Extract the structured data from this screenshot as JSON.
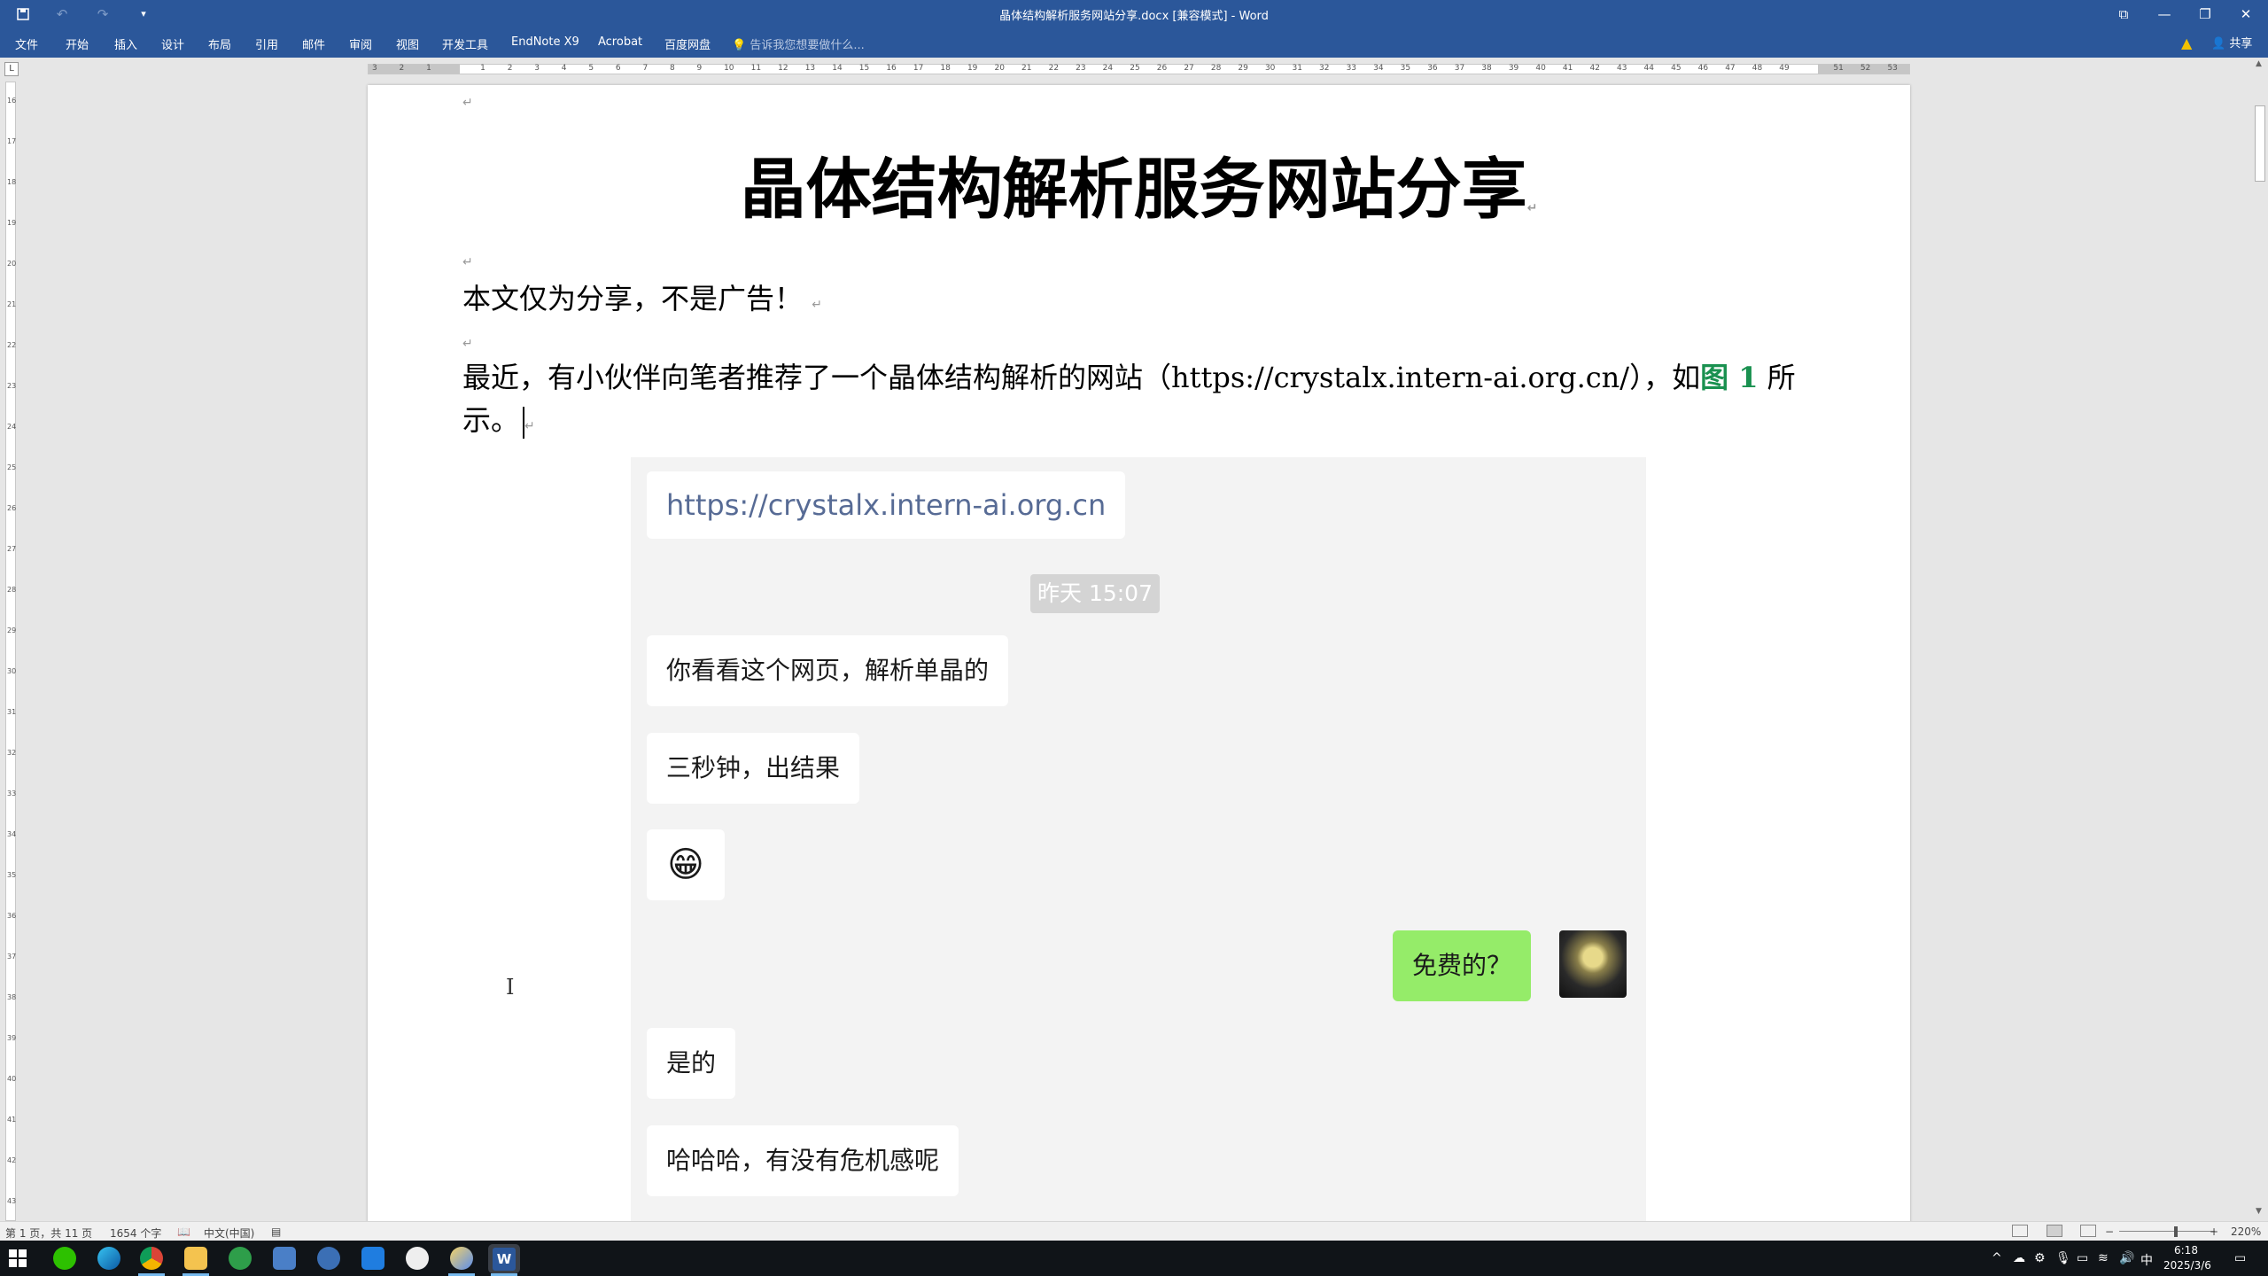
{
  "window": {
    "title": "晶体结构解析服务网站分享.docx [兼容模式] - Word",
    "minimize_glyph": "—",
    "restore_glyph": "❐",
    "close_glyph": "✕",
    "ribbon_display_glyph": "⧉"
  },
  "quick_access": {
    "save_icon": "save-icon",
    "undo_icon": "undo-icon",
    "redo_icon": "redo-icon",
    "customize_icon": "customize-icon"
  },
  "ribbon": {
    "tabs": [
      "文件",
      "开始",
      "插入",
      "设计",
      "布局",
      "引用",
      "邮件",
      "审阅",
      "视图",
      "开发工具",
      "EndNote X9",
      "Acrobat",
      "百度网盘"
    ],
    "tell_me": "告诉我您想要做什么...",
    "share": "共享"
  },
  "ruler": {
    "tab_selector": "L"
  },
  "document": {
    "heading": "晶体结构解析服务网站分享",
    "para_ad": "本文仅为分享，不是广告！",
    "para_intro_text": "最近，有小伙伴向笔者推荐了一个晶体结构解析的网站（https://crystalx.intern-ai.org.cn/），如",
    "figure_ref": "图 1",
    "para_intro_tail": "所示。",
    "para_mark": "↵"
  },
  "chat": {
    "link": "https://crystalx.intern-ai.org.cn",
    "timestamp": "昨天 15:07",
    "messages": [
      "你看看这个网页，解析单晶的",
      "三秒钟，出结果",
      "😁",
      "免费的？",
      "是的",
      "哈哈哈，有没有危机感呢"
    ],
    "bubble_colors": {
      "incoming": "#ffffff",
      "outgoing": "#95ec69",
      "link": "#576b95"
    }
  },
  "statusbar": {
    "page": "第 1 页，共 11 页",
    "word_count": "1654 个字",
    "language": "中文(中国)",
    "zoom": "220%",
    "zoom_minus": "−",
    "zoom_plus": "+"
  },
  "taskbar": {
    "time": "6:18",
    "date": "2025/3/6",
    "ime": "中",
    "apps": [
      "wechat-icon",
      "edge-icon",
      "chrome-icon",
      "file-explorer-icon",
      "app-icon",
      "calculator-icon",
      "browser-icon",
      "mail-icon",
      "qq-icon",
      "app-icon-2",
      "word-icon"
    ]
  },
  "colors": {
    "word_blue": "#2b579a",
    "figure_ref": "#1a9150"
  }
}
